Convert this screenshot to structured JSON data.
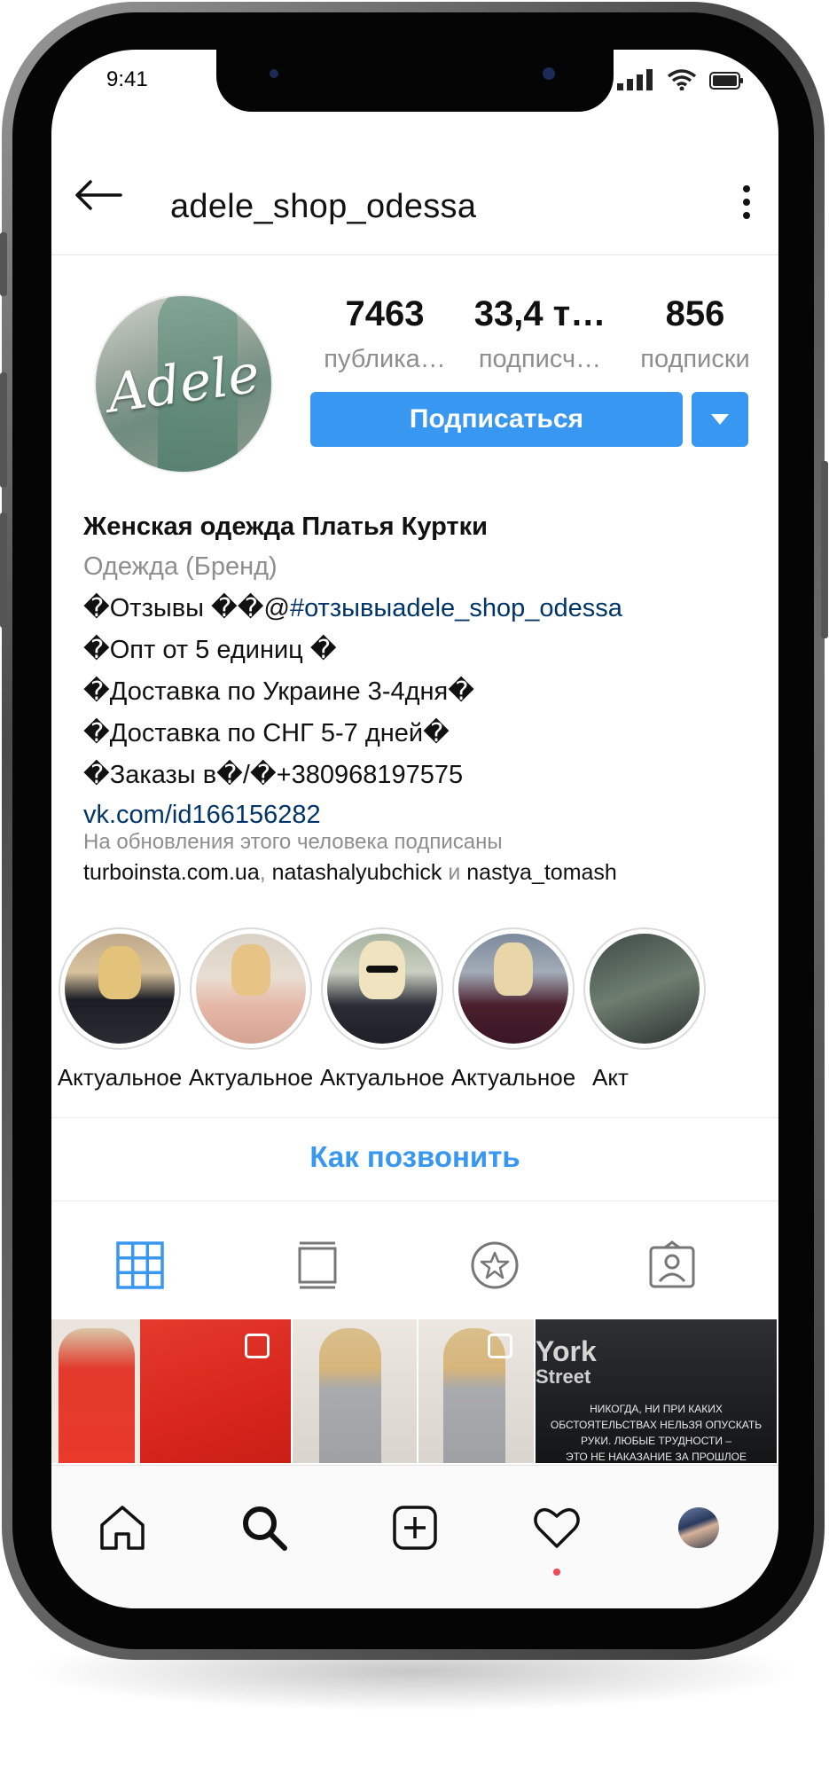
{
  "status_bar": {
    "time": "9:41"
  },
  "header": {
    "username": "adele_shop_odessa"
  },
  "profile": {
    "avatar_logo": "Adele",
    "stats": [
      {
        "value": "7463",
        "label": "публика…"
      },
      {
        "value": "33,4 т…",
        "label": "подписч…"
      },
      {
        "value": "856",
        "label": "подписки"
      }
    ],
    "follow_label": "Подписаться"
  },
  "bio": {
    "name": "Женская одежда Платья Куртки",
    "category": "Одежда (Бренд)",
    "line1_prefix": "�Отзывы ��@",
    "line1_tag": "#отзывыadele_shop_odessa",
    "line2": "�Опт от 5 единиц �",
    "line3": "�Доставка по Украине 3-4дня�",
    "line4": "�Доставка по СНГ 5-7 дней�",
    "line5": "�Заказы в�/�+380968197575",
    "link": "vk.com/id166156282"
  },
  "followed_by": {
    "caption": "На обновления этого человека подписаны",
    "name1": "turboinsta.com.ua",
    "sep1": ", ",
    "name2": "natashalyubchick",
    "sep2": " и ",
    "name3": "nastya_tomash"
  },
  "highlights": [
    {
      "label": "Актуальное"
    },
    {
      "label": "Актуальное"
    },
    {
      "label": "Актуальное"
    },
    {
      "label": "Актуальное"
    },
    {
      "label": "Акт"
    }
  ],
  "contact": {
    "call_label": "Как позвонить"
  },
  "grid_posts": {
    "post3_text1": "York",
    "post3_text2": "Street",
    "post3_caption_1": "НИКОГДА, НИ ПРИ КАКИХ",
    "post3_caption_2": "ОБСТОЯТЕЛЬСТВАХ НЕЛЬЗЯ ОПУСКАТЬ",
    "post3_caption_3": "РУКИ. ЛЮБЫЕ ТРУДНОСТИ –",
    "post3_caption_4": "ЭТО НЕ НАКАЗАНИЕ ЗА ПРОШЛОЕ"
  },
  "colors": {
    "accent": "#3897f0",
    "link": "#003569",
    "muted": "#8e8e8e",
    "notification_dot": "#ed4956"
  },
  "icons": {
    "status": [
      "signal-icon",
      "wifi-icon",
      "battery-icon"
    ],
    "header": [
      "back-arrow-icon",
      "more-vertical-icon"
    ],
    "tabs": [
      "grid-icon",
      "feed-icon",
      "star-icon",
      "tagged-icon"
    ],
    "nav": [
      "home-icon",
      "search-icon",
      "add-icon",
      "heart-icon",
      "profile-avatar"
    ]
  }
}
